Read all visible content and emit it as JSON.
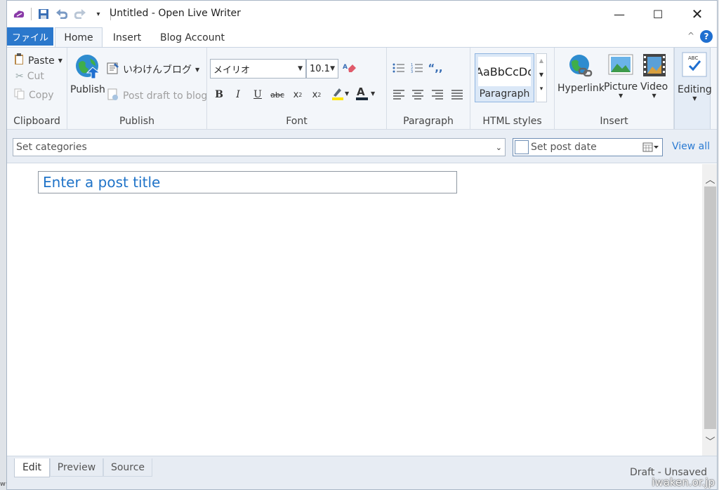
{
  "window": {
    "title": "Untitled - Open Live Writer"
  },
  "tabs": {
    "file": "ファイル",
    "home": "Home",
    "insert": "Insert",
    "blog_account": "Blog Account",
    "help": "?"
  },
  "clipboard": {
    "paste": "Paste",
    "cut": "Cut",
    "copy": "Copy",
    "label": "Clipboard"
  },
  "publish": {
    "publish": "Publish",
    "blog": "いわけんブログ",
    "draft": "Post draft to blog",
    "label": "Publish"
  },
  "font": {
    "family": "メイリオ",
    "size": "10.1",
    "label": "Font"
  },
  "paragraph": {
    "label": "Paragraph"
  },
  "html_styles": {
    "preview": "AaBbCcDc",
    "name": "Paragraph",
    "label": "HTML styles"
  },
  "insert": {
    "hyperlink": "Hyperlink",
    "picture": "Picture",
    "video": "Video",
    "label": "Insert"
  },
  "editing": {
    "label": "Editing"
  },
  "categories": {
    "placeholder": "Set categories"
  },
  "post_date": {
    "placeholder": "Set post date"
  },
  "view_all": "View all",
  "post_title": {
    "placeholder": "Enter a post title"
  },
  "view_tabs": [
    "Edit",
    "Preview",
    "Source"
  ],
  "status": "Draft - Unsaved",
  "watermark": "iwaken.or.jp",
  "colors": {
    "accent": "#2b78cc",
    "link": "#2a7ad2",
    "ribbon": "#f3f6fa"
  }
}
